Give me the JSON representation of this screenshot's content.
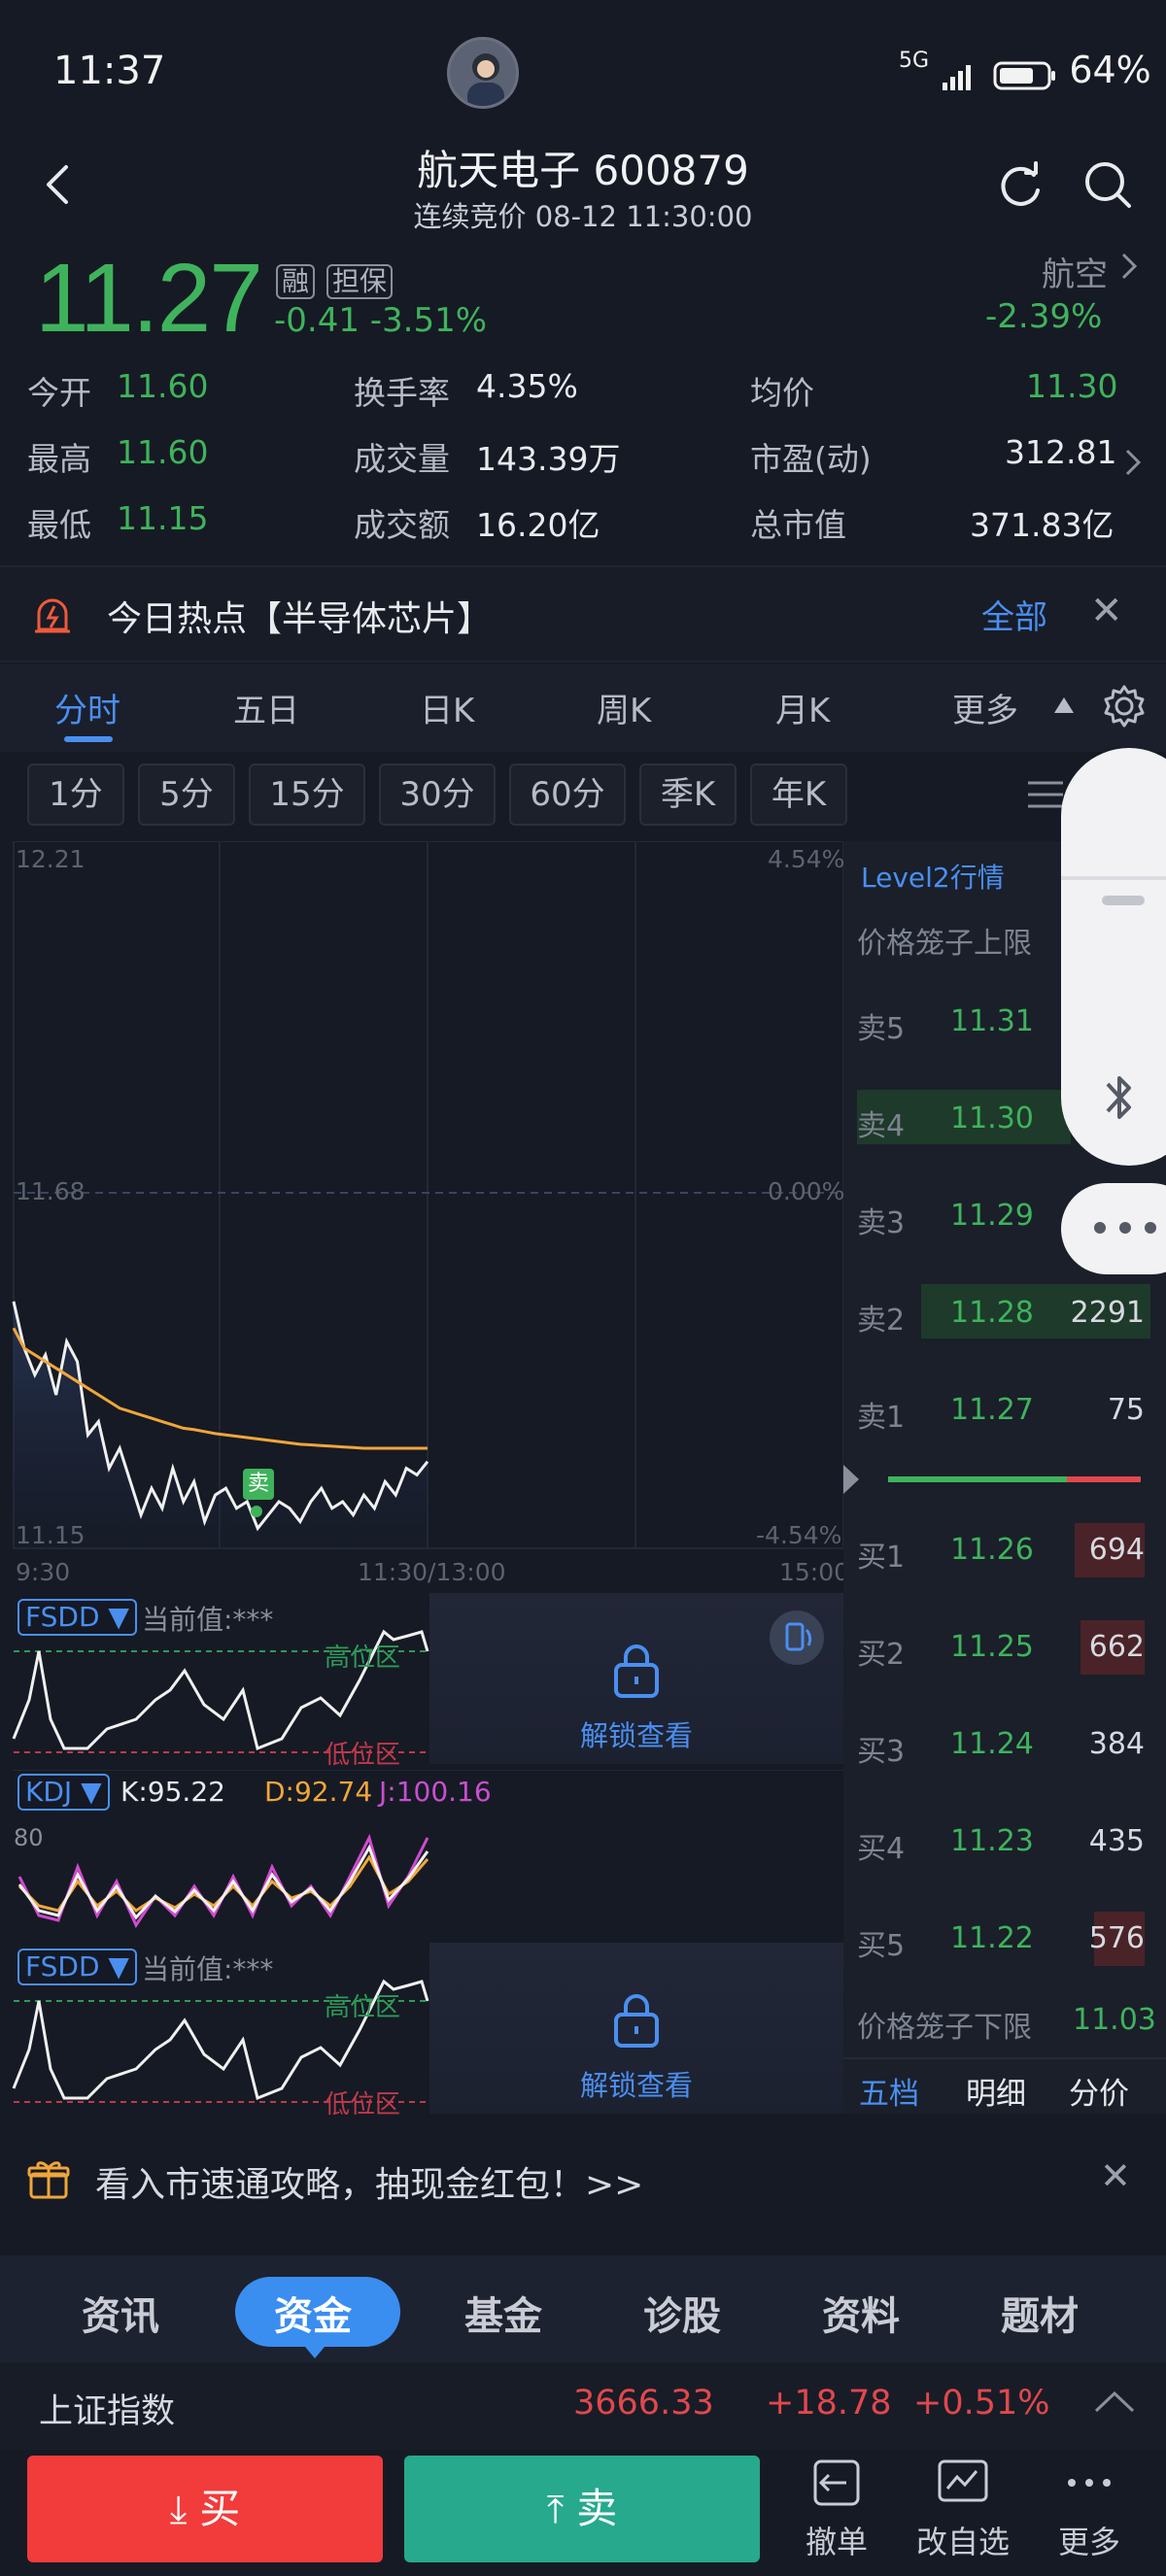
{
  "status_bar": {
    "time": "11:37",
    "network": "5G",
    "battery": "64%"
  },
  "header": {
    "title": "航天电子 600879",
    "subtitle": "连续竞价 08-12 11:30:00"
  },
  "quote": {
    "price": "11.27",
    "tags": [
      "融",
      "担保"
    ],
    "change": "-0.41  -3.51%",
    "sector": {
      "name": "航空",
      "change": "-2.39%"
    }
  },
  "stats": {
    "open_label": "今开",
    "open": "11.60",
    "high_label": "最高",
    "high": "11.60",
    "low_label": "最低",
    "low": "11.15",
    "turnover_label": "换手率",
    "turnover": "4.35%",
    "volume_label": "成交量",
    "volume": "143.39万",
    "amount_label": "成交额",
    "amount": "16.20亿",
    "avg_label": "均价",
    "avg": "11.30",
    "pe_label": "市盈(动)",
    "pe": "312.81",
    "mcap_label": "总市值",
    "mcap": "371.83亿"
  },
  "hot": {
    "text": "今日热点【半导体芯片】",
    "all": "全部"
  },
  "tabs": [
    "分时",
    "五日",
    "日K",
    "周K",
    "月K",
    "更多"
  ],
  "periods": [
    "1分",
    "5分",
    "15分",
    "30分",
    "60分",
    "季K",
    "年K"
  ],
  "chart": {
    "y_top": "12.21",
    "y_mid": "11.68",
    "y_bot": "11.15",
    "pct_top": "4.54%",
    "pct_mid": "0.00%",
    "pct_bot": "-4.54%",
    "x_start": "9:30",
    "x_mid": "11:30/13:00",
    "x_end": "15:00",
    "sell_marker": "卖"
  },
  "chart_data": {
    "type": "line",
    "ylim": [
      11.15,
      12.21
    ],
    "series": [
      {
        "name": "price",
        "values": [
          11.52,
          11.45,
          11.41,
          11.44,
          11.38,
          11.46,
          11.43,
          11.32,
          11.34,
          11.27,
          11.3,
          11.25,
          11.2,
          11.24,
          11.21,
          11.27,
          11.22,
          11.25,
          11.19,
          11.23,
          11.24,
          11.21,
          11.22,
          11.18,
          11.2,
          11.22,
          11.21,
          11.19,
          11.22,
          11.24,
          11.21,
          11.22,
          11.2,
          11.23,
          11.21,
          11.25,
          11.23,
          11.27,
          11.26,
          11.28
        ]
      },
      {
        "name": "avg",
        "values": [
          11.48,
          11.45,
          11.44,
          11.43,
          11.42,
          11.41,
          11.4,
          11.39,
          11.38,
          11.37,
          11.36,
          11.355,
          11.35,
          11.345,
          11.34,
          11.335,
          11.33,
          11.328,
          11.325,
          11.322,
          11.32,
          11.318,
          11.316,
          11.314,
          11.312,
          11.31,
          11.308,
          11.306,
          11.305,
          11.304,
          11.303,
          11.302,
          11.301,
          11.3,
          11.3,
          11.3,
          11.3,
          11.3,
          11.3,
          11.3
        ]
      }
    ]
  },
  "order_book": {
    "level2": "Level2行情",
    "upper_limit_label": "价格笼子上限",
    "lower_limit_label": "价格笼子下限",
    "lower_limit": "11.03",
    "asks": [
      {
        "label": "卖5",
        "price": "11.31",
        "vol": ""
      },
      {
        "label": "卖4",
        "price": "11.30",
        "vol": ""
      },
      {
        "label": "卖3",
        "price": "11.29",
        "vol": ""
      },
      {
        "label": "卖2",
        "price": "11.28",
        "vol": "2291"
      },
      {
        "label": "卖1",
        "price": "11.27",
        "vol": "75"
      }
    ],
    "bids": [
      {
        "label": "买1",
        "price": "11.26",
        "vol": "694"
      },
      {
        "label": "买2",
        "price": "11.25",
        "vol": "662"
      },
      {
        "label": "买3",
        "price": "11.24",
        "vol": "384"
      },
      {
        "label": "买4",
        "price": "11.23",
        "vol": "435"
      },
      {
        "label": "买5",
        "price": "11.22",
        "vol": "576"
      }
    ],
    "tabs": [
      "五档",
      "明细",
      "分价"
    ]
  },
  "indicators": {
    "fsdd_tag": "FSDD ▼",
    "fsdd_value": "当前值:***",
    "high_zone": "高位区",
    "low_zone": "低位区",
    "unlock": "解锁查看",
    "kdj_tag": "KDJ ▼",
    "k": "K:95.22",
    "d": "D:92.74",
    "j": "J:100.16",
    "kdj_80": "80"
  },
  "promo": {
    "text": "看入市速通攻略，抽现金红包！>>"
  },
  "bottom_tabs": [
    "资讯",
    "资金",
    "基金",
    "诊股",
    "资料",
    "题材"
  ],
  "index": {
    "name": "上证指数",
    "value": "3666.33",
    "change": "+18.78",
    "pct": "+0.51%"
  },
  "actions": {
    "buy": "买",
    "sell": "卖",
    "cancel": "撤单",
    "edit_watch": "改自选",
    "more": "更多"
  },
  "colors": {
    "up": "#e0484d",
    "down": "#3fb35c",
    "accent": "#4a8ff0",
    "avg_line": "#f0a63a"
  }
}
